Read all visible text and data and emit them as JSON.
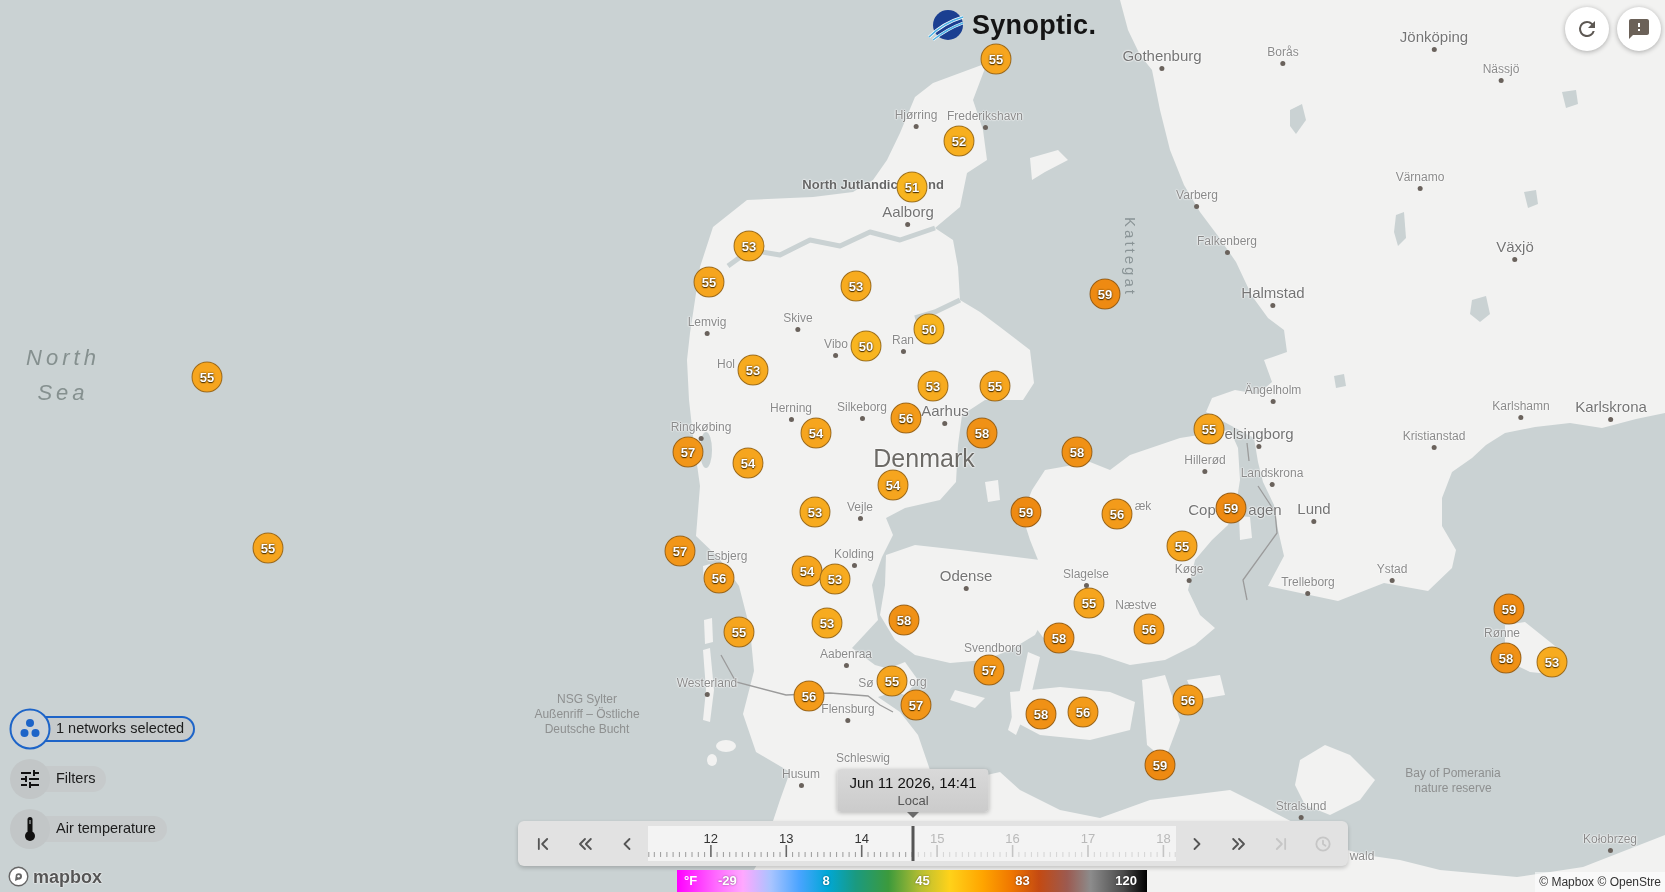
{
  "header": {
    "logo_text": "Synoptic."
  },
  "map": {
    "labels": [
      {
        "text": "Jönköping",
        "kind": "city",
        "dot": true
      },
      {
        "text": "Gothenburg",
        "kind": "city",
        "dot": true
      },
      {
        "text": "Borås",
        "kind": "town",
        "dot": true
      },
      {
        "text": "Nässjö",
        "kind": "town",
        "dot": true
      },
      {
        "text": "Hjørring",
        "kind": "town",
        "dot": true
      },
      {
        "text": "Frederikshavn",
        "kind": "town",
        "dot": true
      },
      {
        "text": "North Jutlandic",
        "kind": "region",
        "dot": false
      },
      {
        "text": "nd",
        "kind": "region",
        "dot": false
      },
      {
        "text": "Värnamo",
        "kind": "town",
        "dot": true
      },
      {
        "text": "Varberg",
        "kind": "town",
        "dot": true
      },
      {
        "text": "Aalborg",
        "kind": "city",
        "dot": true
      },
      {
        "text": "Kattegat",
        "kind": "water-vertical",
        "dot": false
      },
      {
        "text": "Falkenberg",
        "kind": "town",
        "dot": true
      },
      {
        "text": "Växjö",
        "kind": "city",
        "dot": true
      },
      {
        "text": "Halmstad",
        "kind": "city",
        "dot": true
      },
      {
        "text": "Lemvig",
        "kind": "town",
        "dot": true
      },
      {
        "text": "Skive",
        "kind": "town",
        "dot": true
      },
      {
        "lines": [
          "North",
          "Sea"
        ],
        "kind": "water",
        "dot": false
      },
      {
        "text": "Vibo",
        "kind": "town",
        "dot": true
      },
      {
        "text": "Ran",
        "kind": "town",
        "dot": true
      },
      {
        "text": "Hol",
        "kind": "town",
        "dot": false
      },
      {
        "text": "Ängelholm",
        "kind": "town",
        "dot": true
      },
      {
        "text": "Herning",
        "kind": "town",
        "dot": true
      },
      {
        "text": "Silkeborg",
        "kind": "town",
        "dot": true
      },
      {
        "text": "Aarhus",
        "kind": "city",
        "dot": true
      },
      {
        "text": "Karlshamn",
        "kind": "town",
        "dot": true
      },
      {
        "text": "Karlskrona",
        "kind": "city",
        "dot": true
      },
      {
        "text": "Ringkøbing",
        "kind": "town",
        "dot": true
      },
      {
        "text": "elsingborg",
        "kind": "city",
        "dot": true
      },
      {
        "text": "Kristianstad",
        "kind": "town",
        "dot": true
      },
      {
        "text": "Denmark",
        "kind": "country",
        "dot": false
      },
      {
        "text": "Hillerød",
        "kind": "town",
        "dot": true
      },
      {
        "text": "Landskrona",
        "kind": "town",
        "dot": true
      },
      {
        "text": "Vejle",
        "kind": "town",
        "dot": true
      },
      {
        "text": "æk",
        "kind": "town",
        "dot": false
      },
      {
        "text": "Cop",
        "kind": "city",
        "dot": false
      },
      {
        "text": "agen",
        "kind": "city",
        "dot": false
      },
      {
        "text": "Lund",
        "kind": "city",
        "dot": true
      },
      {
        "text": "Esbjerg",
        "kind": "town",
        "dot": false
      },
      {
        "text": "Kolding",
        "kind": "town",
        "dot": true
      },
      {
        "text": "Odense",
        "kind": "city",
        "dot": true
      },
      {
        "text": "Slagelse",
        "kind": "town",
        "dot": true
      },
      {
        "text": "Køge",
        "kind": "town",
        "dot": true
      },
      {
        "text": "Trelleborg",
        "kind": "town",
        "dot": true
      },
      {
        "text": "Ystad",
        "kind": "town",
        "dot": true
      },
      {
        "text": "Næstve",
        "kind": "town",
        "dot": false
      },
      {
        "text": "Rønne",
        "kind": "town",
        "dot": false
      },
      {
        "text": "Aabenraa",
        "kind": "town",
        "dot": true
      },
      {
        "text": "Svendborg",
        "kind": "town",
        "dot": false
      },
      {
        "text": "Westerland",
        "kind": "town",
        "dot": true
      },
      {
        "text": "Sø",
        "kind": "town",
        "dot": false
      },
      {
        "text": "org",
        "kind": "town",
        "dot": false
      },
      {
        "lines": [
          "NSG Sylter",
          "Außenriff – Östliche",
          "Deutsche Bucht"
        ],
        "kind": "reserve",
        "dot": false
      },
      {
        "text": "Flensburg",
        "kind": "town",
        "dot": true
      },
      {
        "text": "Schleswig",
        "kind": "town",
        "dot": false
      },
      {
        "text": "Husum",
        "kind": "town",
        "dot": true
      },
      {
        "lines": [
          "Bay of Pomerania",
          "nature reserve"
        ],
        "kind": "reserve",
        "dot": false
      },
      {
        "text": "Stralsund",
        "kind": "town",
        "dot": true
      },
      {
        "text": "Kołobrzeg",
        "kind": "town",
        "dot": true
      },
      {
        "text": "wald",
        "kind": "town",
        "dot": false
      }
    ],
    "markers": [
      {
        "value": "55",
        "color": "#f6a51e"
      },
      {
        "value": "52",
        "color": "#f7af1f"
      },
      {
        "value": "51",
        "color": "#f8b520"
      },
      {
        "value": "53",
        "color": "#f7ab1f"
      },
      {
        "value": "55",
        "color": "#f6a51e"
      },
      {
        "value": "53",
        "color": "#f7ab1f"
      },
      {
        "value": "59",
        "color": "#ee8a12"
      },
      {
        "value": "50",
        "color": "#f8b520"
      },
      {
        "value": "50",
        "color": "#f8b520"
      },
      {
        "value": "53",
        "color": "#f7ab1f"
      },
      {
        "value": "55",
        "color": "#f6a51e"
      },
      {
        "value": "53",
        "color": "#f7ab1f"
      },
      {
        "value": "55",
        "color": "#f6a51e"
      },
      {
        "value": "56",
        "color": "#f39b1a"
      },
      {
        "value": "54",
        "color": "#f6a51e"
      },
      {
        "value": "58",
        "color": "#f09116"
      },
      {
        "value": "55",
        "color": "#f6a51e"
      },
      {
        "value": "57",
        "color": "#f29618"
      },
      {
        "value": "54",
        "color": "#f6a51e"
      },
      {
        "value": "58",
        "color": "#f09116"
      },
      {
        "value": "54",
        "color": "#f6a51e"
      },
      {
        "value": "59",
        "color": "#ee8a12"
      },
      {
        "value": "56",
        "color": "#f39b1a"
      },
      {
        "value": "59",
        "color": "#ee8a12"
      },
      {
        "value": "53",
        "color": "#f7ab1f"
      },
      {
        "value": "55",
        "color": "#f6a51e"
      },
      {
        "value": "57",
        "color": "#f29618"
      },
      {
        "value": "56",
        "color": "#f39b1a"
      },
      {
        "value": "54",
        "color": "#f6a51e"
      },
      {
        "value": "53",
        "color": "#f7ab1f"
      },
      {
        "value": "55",
        "color": "#f6a51e"
      },
      {
        "value": "55",
        "color": "#f6a51e"
      },
      {
        "value": "53",
        "color": "#f7ab1f"
      },
      {
        "value": "58",
        "color": "#f09116"
      },
      {
        "value": "55",
        "color": "#f6a51e"
      },
      {
        "value": "58",
        "color": "#f09116"
      },
      {
        "value": "56",
        "color": "#f39b1a"
      },
      {
        "value": "59",
        "color": "#ee8a12"
      },
      {
        "value": "58",
        "color": "#f09116"
      },
      {
        "value": "53",
        "color": "#f7ab1f"
      },
      {
        "value": "57",
        "color": "#f29618"
      },
      {
        "value": "55",
        "color": "#f6a51e"
      },
      {
        "value": "56",
        "color": "#f39b1a"
      },
      {
        "value": "57",
        "color": "#f29618"
      },
      {
        "value": "58",
        "color": "#f09116"
      },
      {
        "value": "56",
        "color": "#f39b1a"
      },
      {
        "value": "56",
        "color": "#f39b1a"
      },
      {
        "value": "59",
        "color": "#ee8a12"
      }
    ]
  },
  "layer_controls": [
    {
      "label": "1 networks selected",
      "kind": "networks",
      "selected": true
    },
    {
      "label": "Filters",
      "kind": "filters",
      "selected": false
    },
    {
      "label": "Air temperature",
      "kind": "variable",
      "selected": false
    }
  ],
  "timeline": {
    "buttons": [
      {
        "kind": "first",
        "disabled": false
      },
      {
        "kind": "back-far",
        "disabled": false
      },
      {
        "kind": "back",
        "disabled": false
      },
      {
        "kind": "forward",
        "disabled": false
      },
      {
        "kind": "forward-far",
        "disabled": false
      },
      {
        "kind": "last",
        "disabled": true
      },
      {
        "kind": "live",
        "disabled": true
      }
    ],
    "hours": [
      "12",
      "13",
      "14",
      "15",
      "16",
      "17",
      "18"
    ],
    "level": 0.502,
    "tooltip": {
      "time": "Jun 11 2026, 14:41",
      "zone": "Local"
    }
  },
  "legend": {
    "unit": "°F",
    "ticks": [
      "-29",
      "8",
      "45",
      "83",
      "120"
    ]
  },
  "attribution": {
    "logo_text": "mapbox",
    "text": "© Mapbox © OpenStre"
  }
}
